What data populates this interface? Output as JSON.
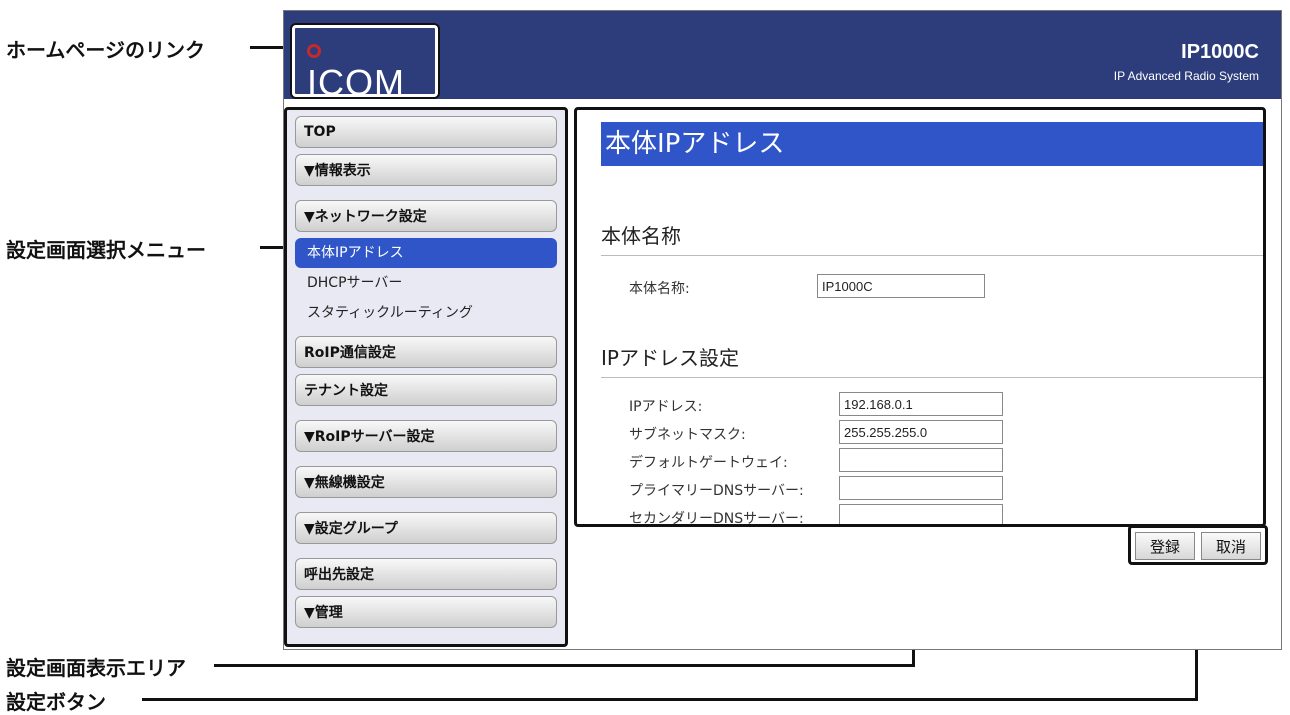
{
  "annotations": {
    "home_link": "ホームページのリンク",
    "menu": "設定画面選択メニュー",
    "display_area": "設定画面表示エリア",
    "settings_buttons": "設定ボタン"
  },
  "header": {
    "logo": "ICOM",
    "product_name": "IP1000C",
    "product_subtitle": "IP Advanced Radio System"
  },
  "menu": {
    "top": "TOP",
    "info": "▼情報表示",
    "network": "▼ネットワーク設定",
    "network_items": [
      "本体IPアドレス",
      "DHCPサーバー",
      "スタティックルーティング"
    ],
    "roip_comm": "RoIP通信設定",
    "tenant": "テナント設定",
    "roip_server": "▼RoIPサーバー設定",
    "radio": "▼無線機設定",
    "group": "▼設定グループ",
    "call_dest": "呼出先設定",
    "admin": "▼管理"
  },
  "content": {
    "page_title": "本体IPアドレス",
    "section_name": "本体名称",
    "name_label": "本体名称:",
    "name_value": "IP1000C",
    "section_ip": "IPアドレス設定",
    "ip_label": "IPアドレス:",
    "ip_value": "192.168.0.1",
    "subnet_label": "サブネットマスク:",
    "subnet_value": "255.255.255.0",
    "gateway_label": "デフォルトゲートウェイ:",
    "gateway_value": "",
    "dns1_label": "プライマリーDNSサーバー:",
    "dns1_value": "",
    "dns2_label": "セカンダリーDNSサーバー:",
    "dns2_value": ""
  },
  "buttons": {
    "register": "登録",
    "cancel": "取消"
  },
  "colors": {
    "header_bg": "#2d3d7c",
    "accent": "#2f55c8"
  }
}
